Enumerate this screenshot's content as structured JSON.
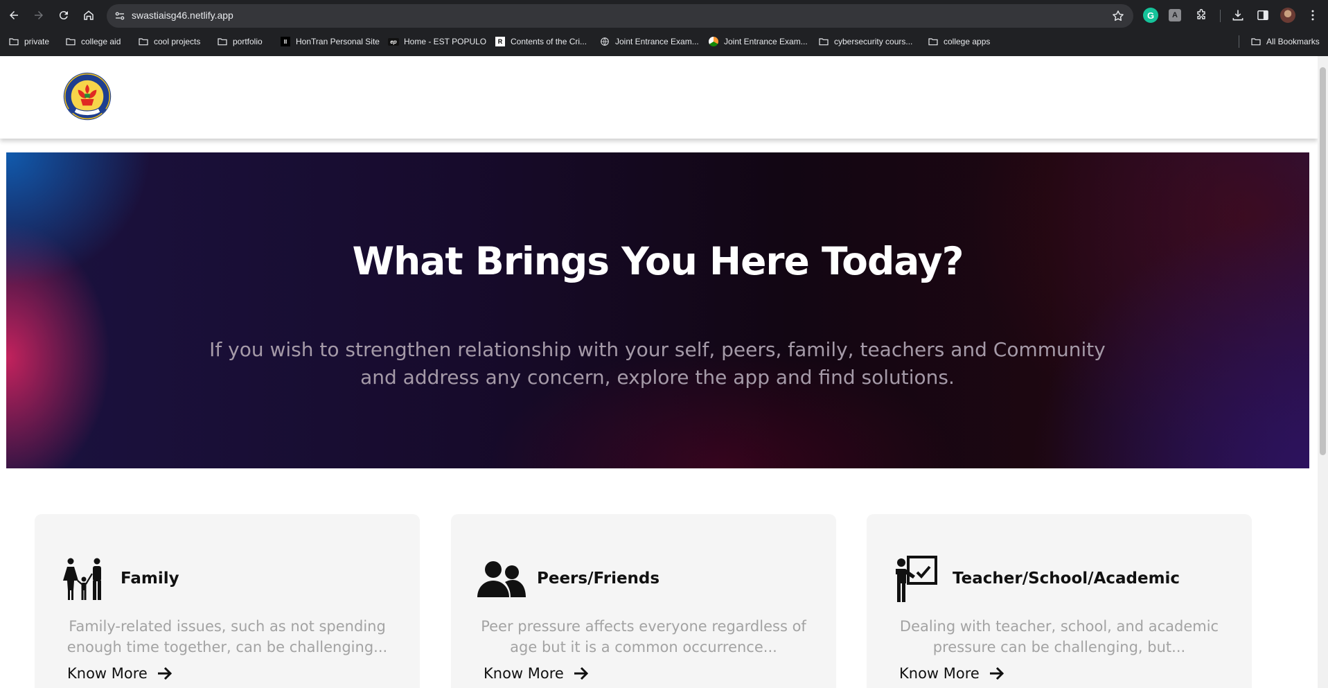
{
  "browser": {
    "url": "swastiaisg46.netlify.app",
    "bookmarks": [
      {
        "label": "private",
        "icon": "folder-icon"
      },
      {
        "label": "college aid",
        "icon": "folder-icon"
      },
      {
        "label": "cool projects",
        "icon": "folder-icon"
      },
      {
        "label": "portfolio",
        "icon": "folder-icon"
      },
      {
        "label": "HonTran Personal Site",
        "icon": "hontran-favicon"
      },
      {
        "label": "Home - EST POPULO",
        "icon": "est-populo-favicon"
      },
      {
        "label": "Contents of the Cri...",
        "icon": "r-favicon"
      },
      {
        "label": "Joint Entrance Exam...",
        "icon": "globe-icon"
      },
      {
        "label": "Joint Entrance Exam...",
        "icon": "india-favicon"
      },
      {
        "label": "cybersecurity cours...",
        "icon": "folder-icon"
      },
      {
        "label": "college apps",
        "icon": "folder-icon"
      }
    ],
    "all_bookmarks": "All Bookmarks",
    "extensions": {
      "grammarly": "G",
      "translate": "A"
    }
  },
  "hero": {
    "title": "What Brings You Here Today?",
    "subtitle": "If you wish to strengthen relationship with your self, peers, family, teachers and Community and address any concern, explore the app and find solutions."
  },
  "cards": [
    {
      "title": "Family",
      "icon": "family-icon",
      "text": "Family-related issues, such as not spending enough time together, can be challenging...",
      "link": "Know More"
    },
    {
      "title": "Peers/Friends",
      "icon": "peers-icon",
      "text": "Peer pressure affects everyone regardless of age but it is a common occurrence...",
      "link": "Know More"
    },
    {
      "title": "Teacher/School/Academic",
      "icon": "teacher-icon",
      "text": "Dealing with teacher, school, and academic pressure can be challenging, but...",
      "link": "Know More"
    }
  ],
  "colors": {
    "chrome_bg": "#202124",
    "omnibox_bg": "#35363a",
    "hero_title": "#ffffff",
    "hero_subtitle": "#a59aa8",
    "card_bg": "#f5f5f5",
    "card_text": "#a3a3a3"
  }
}
